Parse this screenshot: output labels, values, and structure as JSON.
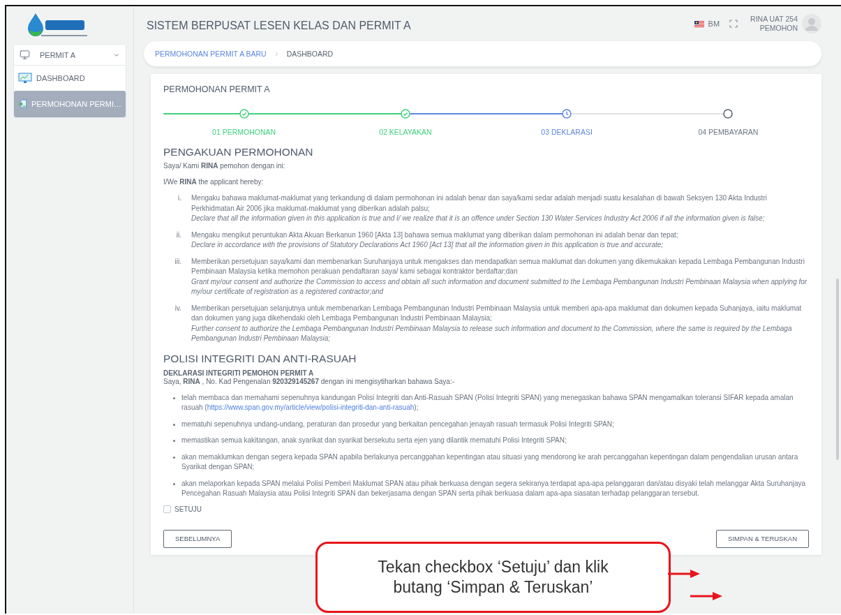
{
  "header": {
    "title": "SISTEM BERPUSAT LESEN KELAS DAN PERMIT A",
    "language": "BM",
    "user_name": "RINA UAT 254",
    "user_role": "PEMOHON"
  },
  "sidebar": {
    "module": "PERMIT A",
    "items": [
      {
        "label": "DASHBOARD",
        "kind": "dashboard",
        "selected": false
      },
      {
        "label": "PERMOHONAN PERMI…",
        "kind": "form",
        "selected": true
      }
    ]
  },
  "breadcrumb": [
    {
      "label": "PERMOHONAN PERMIT A BARU",
      "kind": "link"
    },
    {
      "label": "DASHBOARD",
      "kind": "current"
    }
  ],
  "card_title": "PERMOHONAN PERMIT A",
  "steps": [
    {
      "label": "01 PERMOHONAN",
      "kind": "done"
    },
    {
      "label": "02 KELAYAKAN",
      "kind": "done"
    },
    {
      "label": "03 DEKLARASI",
      "kind": "current"
    },
    {
      "label": "04 PEMBAYARAN",
      "kind": "pending"
    }
  ],
  "acknowledgement": {
    "heading": "PENGAKUAN PERMOHONAN",
    "intro": [
      "Saya/ Kami **RINA** pemohon dengan ini:",
      "I/We **RINA** the applicant hereby:"
    ],
    "items": [
      {
        "marker": "i.",
        "malay": "Mengaku bahawa maklumat-maklumat yang terkandung di dalam permohonan ini adalah benar dan saya/kami sedar adalah menjadi suatu kesalahan di bawah Seksyen 130 Akta Industri Perkhidmatan Air 2006 jika maklumat-maklumat yang diberikan adalah palsu;",
        "english": "Declare that all the information given in this application is true and I/ we realize that it is an offence under Section 130 Water Services Industry Act 2006 if all the information given is false;"
      },
      {
        "marker": "ii.",
        "malay": "Mengaku mengikut peruntukan Akta Akuan Berkanun 1960 [Akta 13] bahawa semua maklumat yang diberikan dalam permohonan ini adalah benar dan tepat;",
        "english": "Declare in accordance with the provisions of Statutory Declarations Act 1960 [Act 13] that all the information given in this application is true and accurate;"
      },
      {
        "marker": "iii.",
        "malay": "Memberikan persetujuan saya/kami dan membenarkan Suruhanjaya untuk mengakses dan mendapatkan semua maklumat dan dokumen yang dikemukakan kepada Lembaga Pembangunan Industri Pembinaan Malaysia ketika memohon perakuan pendaftaran saya/ kami sebagai kontraktor berdaftar;dan",
        "english": "Grant my/our consent and authorize the Commission to access and obtain all such information and document submitted to the Lembaga Pembangunan Industri Pembinaan Malaysia when applying for my/our certificate of registration as a registered contractor;and"
      },
      {
        "marker": "iv.",
        "malay": "Memberikan persetujuan selanjutnya untuk membenarkan Lembaga Pembangunan Industri Pembinaan Malaysia untuk memberi apa-apa maklumat dan dokumen kepada Suhanjaya, iaitu maklumat dan dokumen yang juga dikehendaki oleh Lembaga Pembangunan Industri Pembinaan Malaysia;",
        "english": "Further consent to authorize the Lembaga Pembangunan Industri Pembinaan Malaysia to release such information and document to the Commission, where the same is required by the Lembaga Pembangunan Industri Pembinaan Malaysia;"
      }
    ]
  },
  "integrity": {
    "heading": "POLISI INTEGRITI DAN ANTI-RASUAH",
    "subheading": "DEKLARASI INTEGRITI PEMOHON PERMIT A",
    "statement": "Saya, **RINA** , No. Kad Pengenalan **920329145267** dengan ini mengisytiharkan bahawa Saya:-",
    "items": [
      {
        "text": "telah membaca dan memahami sepenuhnya kandungan Polisi Integriti dan Anti-Rasuah SPAN (Polisi Integriti SPAN) yang menegaskan bahawa SPAN mengamalkan toleransi SIFAR kepada amalan rasuah (",
        "link": "https://www.span.gov.my/article/view/polisi-integriti-dan-anti-rasuah",
        "after": ");"
      },
      {
        "text": "mematuhi sepenuhnya undang-undang, peraturan dan prosedur yang berkaitan pencegahan jenayah rasuah termasuk Polisi Integriti SPAN;"
      },
      {
        "text": "memastikan semua kakitangan, anak syarikat dan syarikat bersekutu serta ejen yang dilantik mematuhi Polisi Integriti SPAN;"
      },
      {
        "text": "akan memaklumkan dengan segera kepada SPAN apabila berlakunya percanggahan kepentingan atau situasi yang mendorong ke arah percanggahan kepentingan dalam pengendalian urusan antara Syarikat dengan SPAN;"
      },
      {
        "text": "akan melaporkan kepada SPAN melalui Polisi Pemberi Maklumat SPAN atau pihak berkuasa dengan segera sekiranya terdapat apa-apa pelanggaran dan/atau disyaki telah melanggar Akta Suruhanjaya Pencegahan Rasuah Malaysia atau Polisi Integriti SPAN dan bekerjasama dengan SPAN serta pihak berkuasa dalam apa-apa siasatan terhadap pelanggaran tersebut."
      }
    ]
  },
  "agree": {
    "label": "SETUJU",
    "checked": false
  },
  "buttons": {
    "back": "SEBELUMNYA",
    "next": "SIMPAN & TERUSKAN"
  },
  "callout": {
    "lines": [
      "Tekan checkbox ‘Setuju’ dan klik",
      "butang ‘Simpan & Teruskan’"
    ]
  }
}
